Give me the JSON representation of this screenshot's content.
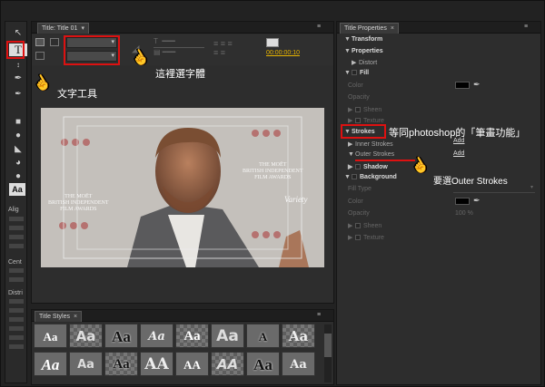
{
  "title_panel": {
    "tab_label": "Title: Title 01",
    "timecode": "00:00:00:10"
  },
  "title_styles": {
    "tab_label": "Title Styles",
    "samples": [
      "Aa",
      "Aa",
      "Aa",
      "Aa",
      "Aa",
      "Aa",
      "A",
      "Aa",
      "Aa",
      "Aa",
      "Aa",
      "AA",
      "AA",
      "AA",
      "Aa",
      "Aa"
    ]
  },
  "left_tools": {
    "labels": {
      "align": "Alig",
      "center": "Cent",
      "distribute": "Distri"
    }
  },
  "properties": {
    "tab_label": "Title Properties",
    "transform": "Transform",
    "properties": "Properties",
    "distort": "Distort",
    "fill": "Fill",
    "color": "Color",
    "opacity": "Opacity",
    "sheen": "Sheen",
    "texture": "Texture",
    "strokes": "Strokes",
    "inner_strokes": "Inner Strokes",
    "outer_strokes": "Outer Strokes",
    "add1": "Add",
    "add2": "Add",
    "shadow": "Shadow",
    "background": "Background",
    "fill_type": "Fill Type",
    "bg_color": "Color",
    "bg_opacity": "Opacity",
    "bg_opacity_value": "100 %",
    "bg_sheen": "Sheen",
    "bg_texture": "Texture"
  },
  "annotations": {
    "choose_font": "這裡選字體",
    "text_tool": "文字工具",
    "strokes_note": "等同photoshop的「筆畫功能」",
    "outer_note": "要選Outer Strokes"
  },
  "video_text": {
    "bafta_left": "THE MOËT",
    "bafta_left2": "BRITISH INDEPENDENT",
    "bafta_left3": "FILM AWARDS",
    "bafta_right": "THE MOËT",
    "bafta_right2": "BRITISH INDEPENDENT",
    "bafta_right3": "FILM AWARDS",
    "variety": "Variety"
  },
  "colors": {
    "accent_red": "#d11111",
    "timecode": "#e8b400",
    "panel_bg": "#2d2d2d"
  }
}
